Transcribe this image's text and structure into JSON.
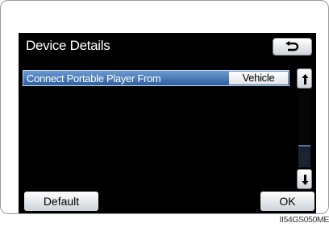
{
  "screen": {
    "title": "Device Details",
    "back_icon": "return-arrow-icon"
  },
  "setting": {
    "label": "Connect Portable Player From",
    "value": "Vehicle"
  },
  "scroll": {
    "up_icon": "scroll-up-arrow-icon",
    "down_icon": "scroll-down-arrow-icon"
  },
  "buttons": {
    "default_label": "Default",
    "ok_label": "OK"
  },
  "caption": "II54GS050ME",
  "colors": {
    "screen_bg": "#000000",
    "row_highlight": "#3f72b3",
    "button_face": "#e6e9ed"
  }
}
